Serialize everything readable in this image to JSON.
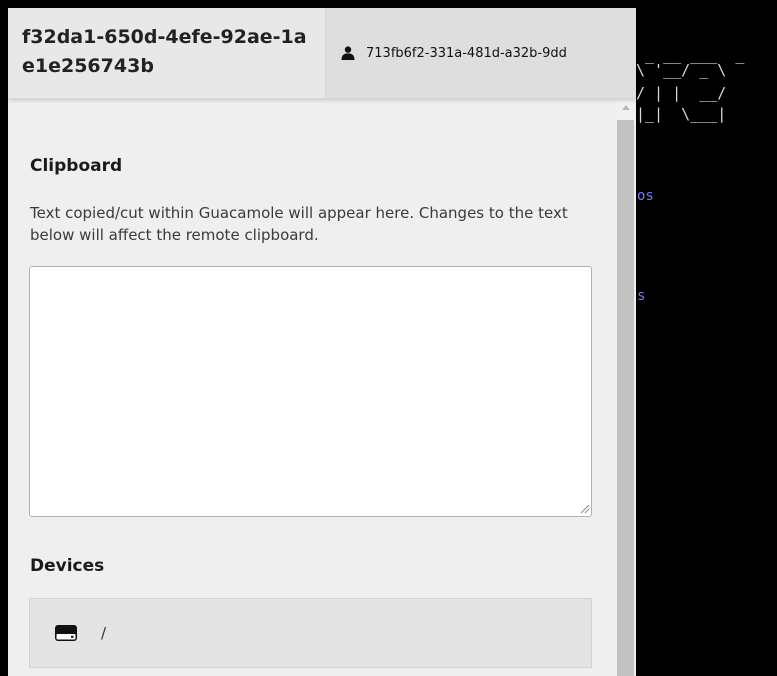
{
  "header": {
    "connection_name": "f32da1-650d-4efe-92ae-1ae1e256743b",
    "user_icon": "user-icon",
    "username": "713fb6f2-331a-481d-a32b-9dd"
  },
  "clipboard": {
    "title": "Clipboard",
    "description": "Text copied/cut within Guacamole will appear here. Changes to the text below will affect the remote clipboard.",
    "value": ""
  },
  "devices": {
    "title": "Devices",
    "items": [
      {
        "icon": "drive-icon",
        "label": "/"
      }
    ]
  },
  "terminal": {
    "ascii_art": [
      " _ __ ___  _",
      "\\ '__/ _ \\",
      "/ | |  __/",
      "|_|  \\___|"
    ],
    "text_lines": [
      "os",
      "s"
    ],
    "text_color": "#7a78ff"
  }
}
